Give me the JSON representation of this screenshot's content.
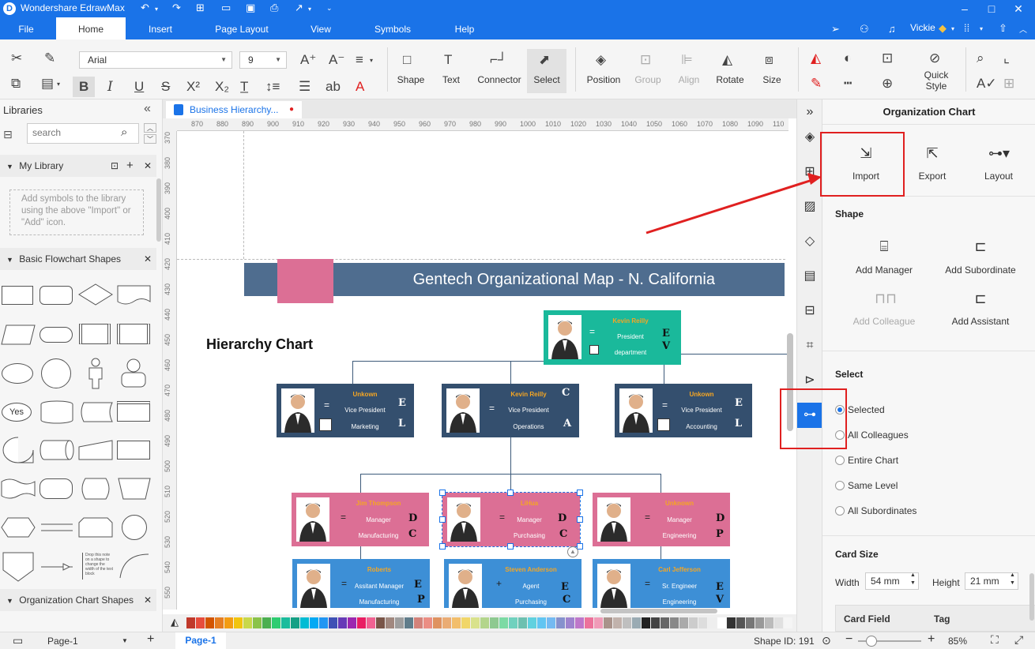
{
  "app": {
    "title": "Wondershare EdrawMax"
  },
  "menu": [
    "File",
    "Home",
    "Insert",
    "Page Layout",
    "View",
    "Symbols",
    "Help"
  ],
  "user": {
    "name": "Vickie"
  },
  "ribbon": {
    "font": "Arial",
    "size": "9",
    "shape": "Shape",
    "text": "Text",
    "connector": "Connector",
    "select": "Select",
    "position": "Position",
    "group": "Group",
    "align": "Align",
    "rotate": "Rotate",
    "size_label": "Size",
    "quick_style": "Quick Style"
  },
  "left": {
    "title": "Libraries",
    "search_placeholder": "search",
    "my_library": "My Library",
    "my_library_hint": "Add symbols to the library using the above \"Import\" or \"Add\" icon.",
    "basic_flowchart": "Basic Flowchart Shapes",
    "org_shapes": "Organization Chart Shapes",
    "yes_shape": "Yes",
    "thumb_text": "Drop this note on a shape to change the width of the text block"
  },
  "canvas": {
    "tab": "Business Hierarchy...",
    "hruler": [
      "870",
      "880",
      "890",
      "900",
      "910",
      "920",
      "930",
      "940",
      "950",
      "960",
      "970",
      "980",
      "990",
      "1000",
      "1010",
      "1020",
      "1030",
      "1040",
      "1050",
      "1060",
      "1070",
      "1080",
      "1090",
      "110"
    ],
    "vruler": [
      "370",
      "380",
      "390",
      "400",
      "410",
      "420",
      "430",
      "440",
      "450",
      "460",
      "470",
      "480",
      "490",
      "500",
      "510",
      "520",
      "530",
      "540",
      "550"
    ],
    "banner_title": "Gentech Organizational Map - N. California",
    "hierarchy_title": "Hierarchy Chart",
    "cards": {
      "president": {
        "name": "Kevin Reilly",
        "title": "President",
        "dept": "department",
        "l1": "E",
        "l2": "V"
      },
      "vp_marketing": {
        "name": "Unkown",
        "title": "Vice President",
        "dept": "Marketing",
        "l1": "E",
        "l2": "L"
      },
      "vp_operations": {
        "name": "Kevin Reilly",
        "title": "Vice President",
        "dept": "Operations",
        "l1": "C",
        "l2": "A"
      },
      "vp_accounting": {
        "name": "Unkown",
        "title": "Vice President",
        "dept": "Accounting",
        "l1": "E",
        "l2": "L"
      },
      "mgr_manufacturing": {
        "name": "Jim Thompson",
        "title": "Manager",
        "dept": "Manufacturing",
        "l1": "D",
        "l2": "C"
      },
      "mgr_purchasing": {
        "name": "LiHua",
        "title": "Manager",
        "dept": "Purchasing",
        "l1": "D",
        "l2": "C"
      },
      "mgr_engineering": {
        "name": "Unknown",
        "title": "Manager",
        "dept": "Engineering",
        "l1": "D",
        "l2": "P"
      },
      "asst_manufacturing": {
        "name": "Roberts",
        "title": "Assitant Manager",
        "dept": "Manufacturing",
        "l1": "E",
        "l2": "P"
      },
      "agent_purchasing": {
        "name": "Steven Anderson",
        "title": "Agent",
        "dept": "Purchasing",
        "l1": "E",
        "l2": "C"
      },
      "eng_engineering": {
        "name": "Carl Jefferson",
        "title": "Sr. Engineer",
        "dept": "Engineering",
        "l1": "E",
        "l2": "V"
      }
    }
  },
  "right": {
    "title": "Organization Chart",
    "import": "Import",
    "export": "Export",
    "layout": "Layout",
    "shape_section": "Shape",
    "add_manager": "Add Manager",
    "add_subordinate": "Add Subordinate",
    "add_colleague": "Add Colleague",
    "add_assistant": "Add Assistant",
    "select_section": "Select",
    "select_options": [
      "Selected",
      "All Colleagues",
      "Entire Chart",
      "Same Level",
      "All Subordinates"
    ],
    "card_size": "Card Size",
    "width_label": "Width",
    "width_value": "54 mm",
    "height_label": "Height",
    "height_value": "21 mm",
    "card_field": "Card Field",
    "tag": "Tag"
  },
  "status": {
    "page_select": "Page-1",
    "page_tab": "Page-1",
    "shape_id": "Shape ID: 191",
    "zoom": "85%"
  },
  "colors": {
    "accent": "#1a73e8",
    "banner": "#4f6d8f",
    "pink": "#dc6f95",
    "teal": "#1ab99b",
    "navy": "#344f6e",
    "blue": "#3d8fd6",
    "highlight": "#e02020"
  }
}
